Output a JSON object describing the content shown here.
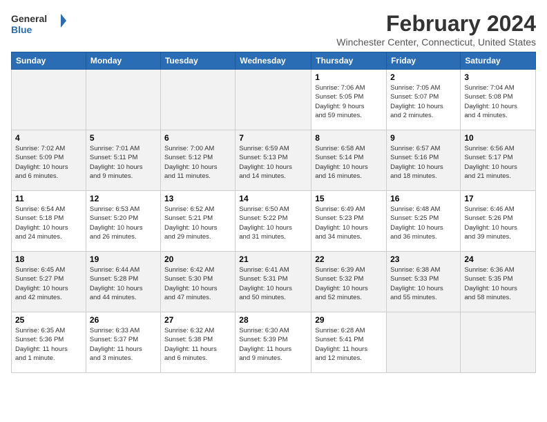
{
  "header": {
    "logo_line1": "General",
    "logo_line2": "Blue",
    "month": "February 2024",
    "location": "Winchester Center, Connecticut, United States"
  },
  "days_of_week": [
    "Sunday",
    "Monday",
    "Tuesday",
    "Wednesday",
    "Thursday",
    "Friday",
    "Saturday"
  ],
  "weeks": [
    [
      {
        "day": "",
        "info": ""
      },
      {
        "day": "",
        "info": ""
      },
      {
        "day": "",
        "info": ""
      },
      {
        "day": "",
        "info": ""
      },
      {
        "day": "1",
        "info": "Sunrise: 7:06 AM\nSunset: 5:05 PM\nDaylight: 9 hours\nand 59 minutes."
      },
      {
        "day": "2",
        "info": "Sunrise: 7:05 AM\nSunset: 5:07 PM\nDaylight: 10 hours\nand 2 minutes."
      },
      {
        "day": "3",
        "info": "Sunrise: 7:04 AM\nSunset: 5:08 PM\nDaylight: 10 hours\nand 4 minutes."
      }
    ],
    [
      {
        "day": "4",
        "info": "Sunrise: 7:02 AM\nSunset: 5:09 PM\nDaylight: 10 hours\nand 6 minutes."
      },
      {
        "day": "5",
        "info": "Sunrise: 7:01 AM\nSunset: 5:11 PM\nDaylight: 10 hours\nand 9 minutes."
      },
      {
        "day": "6",
        "info": "Sunrise: 7:00 AM\nSunset: 5:12 PM\nDaylight: 10 hours\nand 11 minutes."
      },
      {
        "day": "7",
        "info": "Sunrise: 6:59 AM\nSunset: 5:13 PM\nDaylight: 10 hours\nand 14 minutes."
      },
      {
        "day": "8",
        "info": "Sunrise: 6:58 AM\nSunset: 5:14 PM\nDaylight: 10 hours\nand 16 minutes."
      },
      {
        "day": "9",
        "info": "Sunrise: 6:57 AM\nSunset: 5:16 PM\nDaylight: 10 hours\nand 18 minutes."
      },
      {
        "day": "10",
        "info": "Sunrise: 6:56 AM\nSunset: 5:17 PM\nDaylight: 10 hours\nand 21 minutes."
      }
    ],
    [
      {
        "day": "11",
        "info": "Sunrise: 6:54 AM\nSunset: 5:18 PM\nDaylight: 10 hours\nand 24 minutes."
      },
      {
        "day": "12",
        "info": "Sunrise: 6:53 AM\nSunset: 5:20 PM\nDaylight: 10 hours\nand 26 minutes."
      },
      {
        "day": "13",
        "info": "Sunrise: 6:52 AM\nSunset: 5:21 PM\nDaylight: 10 hours\nand 29 minutes."
      },
      {
        "day": "14",
        "info": "Sunrise: 6:50 AM\nSunset: 5:22 PM\nDaylight: 10 hours\nand 31 minutes."
      },
      {
        "day": "15",
        "info": "Sunrise: 6:49 AM\nSunset: 5:23 PM\nDaylight: 10 hours\nand 34 minutes."
      },
      {
        "day": "16",
        "info": "Sunrise: 6:48 AM\nSunset: 5:25 PM\nDaylight: 10 hours\nand 36 minutes."
      },
      {
        "day": "17",
        "info": "Sunrise: 6:46 AM\nSunset: 5:26 PM\nDaylight: 10 hours\nand 39 minutes."
      }
    ],
    [
      {
        "day": "18",
        "info": "Sunrise: 6:45 AM\nSunset: 5:27 PM\nDaylight: 10 hours\nand 42 minutes."
      },
      {
        "day": "19",
        "info": "Sunrise: 6:44 AM\nSunset: 5:28 PM\nDaylight: 10 hours\nand 44 minutes."
      },
      {
        "day": "20",
        "info": "Sunrise: 6:42 AM\nSunset: 5:30 PM\nDaylight: 10 hours\nand 47 minutes."
      },
      {
        "day": "21",
        "info": "Sunrise: 6:41 AM\nSunset: 5:31 PM\nDaylight: 10 hours\nand 50 minutes."
      },
      {
        "day": "22",
        "info": "Sunrise: 6:39 AM\nSunset: 5:32 PM\nDaylight: 10 hours\nand 52 minutes."
      },
      {
        "day": "23",
        "info": "Sunrise: 6:38 AM\nSunset: 5:33 PM\nDaylight: 10 hours\nand 55 minutes."
      },
      {
        "day": "24",
        "info": "Sunrise: 6:36 AM\nSunset: 5:35 PM\nDaylight: 10 hours\nand 58 minutes."
      }
    ],
    [
      {
        "day": "25",
        "info": "Sunrise: 6:35 AM\nSunset: 5:36 PM\nDaylight: 11 hours\nand 1 minute."
      },
      {
        "day": "26",
        "info": "Sunrise: 6:33 AM\nSunset: 5:37 PM\nDaylight: 11 hours\nand 3 minutes."
      },
      {
        "day": "27",
        "info": "Sunrise: 6:32 AM\nSunset: 5:38 PM\nDaylight: 11 hours\nand 6 minutes."
      },
      {
        "day": "28",
        "info": "Sunrise: 6:30 AM\nSunset: 5:39 PM\nDaylight: 11 hours\nand 9 minutes."
      },
      {
        "day": "29",
        "info": "Sunrise: 6:28 AM\nSunset: 5:41 PM\nDaylight: 11 hours\nand 12 minutes."
      },
      {
        "day": "",
        "info": ""
      },
      {
        "day": "",
        "info": ""
      }
    ]
  ]
}
